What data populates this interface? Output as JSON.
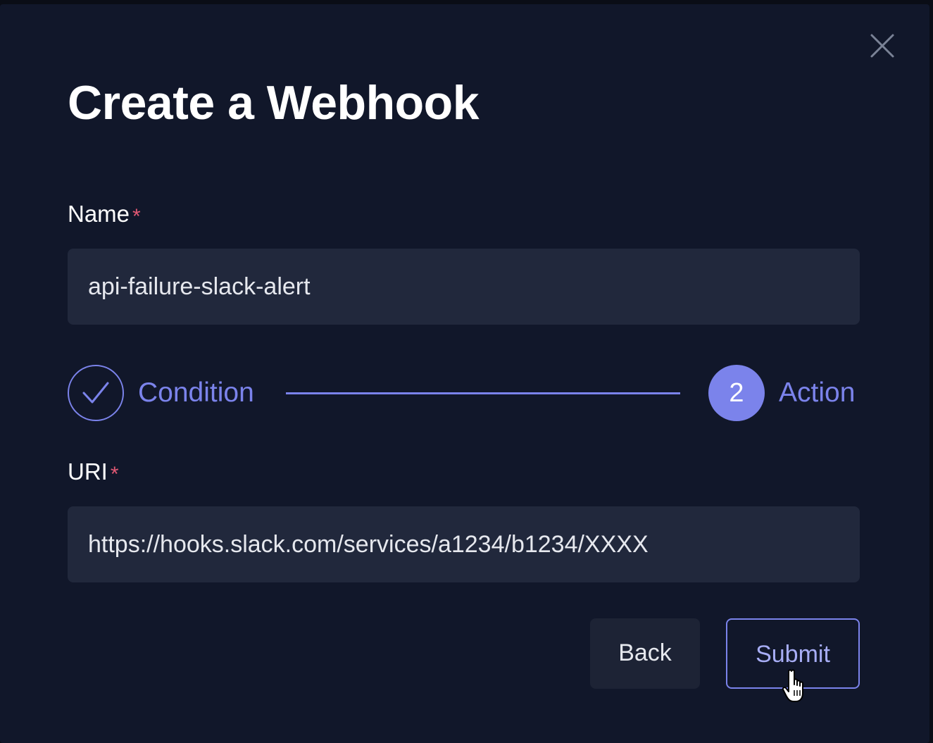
{
  "dialog": {
    "title": "Create a Webhook",
    "close_icon": "close-icon"
  },
  "name_field": {
    "label": "Name",
    "required_mark": "*",
    "value": "api-failure-slack-alert"
  },
  "stepper": {
    "steps": [
      {
        "label": "Condition",
        "status": "completed",
        "icon": "checkmark-icon"
      },
      {
        "label": "Action",
        "status": "active",
        "number": "2"
      }
    ],
    "accent_color": "#7b83eb"
  },
  "uri_field": {
    "label": "URI",
    "required_mark": "*",
    "value": "https://hooks.slack.com/services/a1234/b1234/XXXX"
  },
  "actions": {
    "back_label": "Back",
    "submit_label": "Submit"
  },
  "colors": {
    "background": "#11172a",
    "input_background": "#21283c",
    "accent": "#7b83eb",
    "required": "#e05873"
  }
}
